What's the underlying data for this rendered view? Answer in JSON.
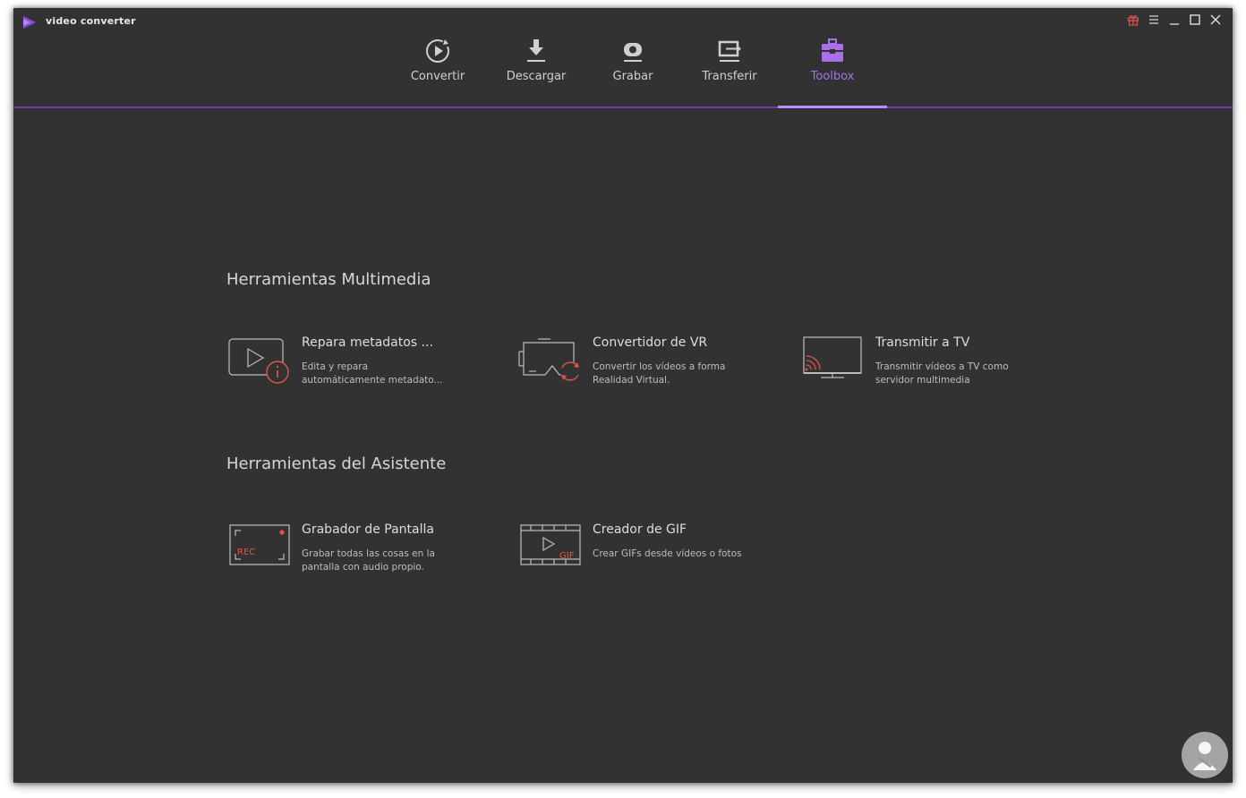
{
  "app": {
    "title": "video converter",
    "brand_color": "#8a4bd9"
  },
  "window_controls": [
    {
      "name": "gift-icon",
      "color": "#e2544a"
    },
    {
      "name": "menu-icon"
    },
    {
      "name": "minimize-icon"
    },
    {
      "name": "maximize-icon"
    },
    {
      "name": "close-icon"
    }
  ],
  "nav": {
    "active_tab": "Toolbox",
    "accent_color": "#a86fe8",
    "tabs": [
      {
        "label": "Convertir",
        "icon": "convert-icon"
      },
      {
        "label": "Descargar",
        "icon": "download-icon"
      },
      {
        "label": "Grabar",
        "icon": "record-icon"
      },
      {
        "label": "Transferir",
        "icon": "transfer-icon"
      },
      {
        "label": "Toolbox",
        "icon": "toolbox-icon"
      }
    ]
  },
  "sections": [
    {
      "title": "Herramientas Multimedia",
      "tools": [
        {
          "title": "Repara metadatos ...",
          "description": "Edita y repara automáticamente metadato...",
          "icon": "metadata-repair-icon"
        },
        {
          "title": "Convertidor de VR",
          "description": "Convertir los vídeos a forma Realidad Virtual.",
          "icon": "vr-converter-icon"
        },
        {
          "title": "Transmitir a TV",
          "description": "Transmitir vídeos a TV como servidor multimedia",
          "icon": "cast-to-tv-icon"
        }
      ]
    },
    {
      "title": "Herramientas del Asistente",
      "tools": [
        {
          "title": "Grabador de Pantalla",
          "description": "Grabar todas las cosas en la pantalla con audio propio.",
          "icon": "screen-recorder-icon",
          "icon_text": "REC"
        },
        {
          "title": "Creador de GIF",
          "description": "Crear GIFs desde vídeos o fotos",
          "icon": "gif-maker-icon",
          "icon_text": "GIF"
        }
      ]
    }
  ],
  "colors": {
    "icon_accent": "#e2544a",
    "icon_stroke": "#bdbdbd",
    "background": "#323232"
  }
}
